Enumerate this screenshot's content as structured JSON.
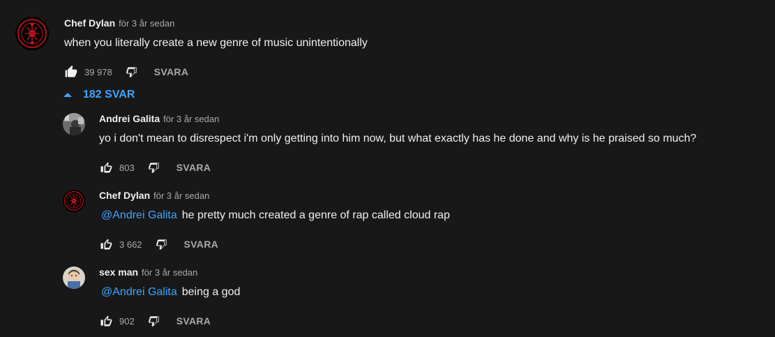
{
  "top_comment": {
    "author": "Chef Dylan",
    "time": "för 3 år sedan",
    "text": "when you literally create a new genre of music unintentionally",
    "likes": "39 978",
    "reply_label": "SVARA",
    "like_icon": "thumbs-up-filled-icon",
    "dislike_icon": "thumbs-down-icon"
  },
  "replies_toggle": {
    "label": "182 SVAR",
    "icon": "chevron-up-icon"
  },
  "replies": [
    {
      "author": "Andrei Galita",
      "time": "för 3 år sedan",
      "mention": "",
      "text": "yo i don't mean to disrespect i'm only getting into him now, but what exactly has he done and why is he praised so much?",
      "likes": "803",
      "reply_label": "SVARA"
    },
    {
      "author": "Chef Dylan",
      "time": "för 3 år sedan",
      "mention": "@Andrei Galita",
      "text": "he pretty much created a genre of rap called cloud rap",
      "likes": "3 662",
      "reply_label": "SVARA"
    },
    {
      "author": "sex man",
      "time": "för 3 år sedan",
      "mention": "@Andrei Galita",
      "text": "being a god",
      "likes": "902",
      "reply_label": "SVARA"
    }
  ],
  "colors": {
    "background": "#181818",
    "link": "#3ea6ff",
    "secondary_text": "#aaaaaa",
    "primary_text": "#f1f1f1"
  }
}
